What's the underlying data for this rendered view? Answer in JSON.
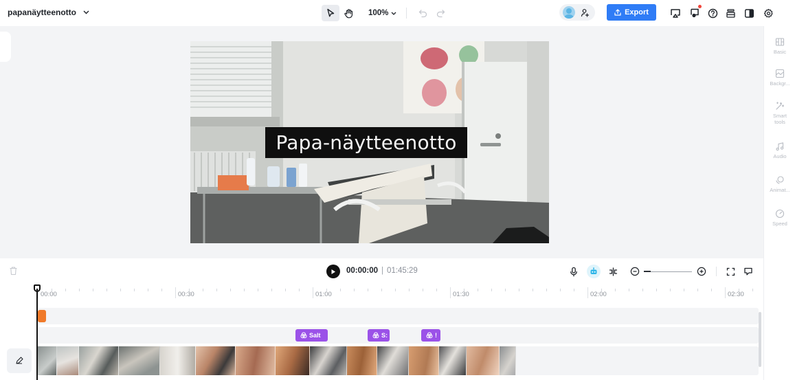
{
  "header": {
    "project_name": "papanäytteenotto",
    "zoom": "100%",
    "export_label": "Export"
  },
  "canvas": {
    "caption": "Papa-näytteenotto"
  },
  "right_panel": {
    "items": [
      {
        "label": "Basic"
      },
      {
        "label": "Backgr..."
      },
      {
        "label": "Smart tools"
      },
      {
        "label": "Audio"
      },
      {
        "label": "Animat..."
      },
      {
        "label": "Speed"
      }
    ]
  },
  "playback": {
    "current_time": "00:00:00",
    "separator": "|",
    "total_time": "01:45:29",
    "zoom_level": 0.14
  },
  "timeline": {
    "ruler_labels": [
      "00:00",
      "00:30",
      "01:00",
      "01:30",
      "02:00",
      "02:30"
    ],
    "effects": [
      {
        "label": "Salt"
      },
      {
        "label": "S:"
      },
      {
        "label": "!"
      }
    ]
  },
  "colors": {
    "accent": "#2f7cf6",
    "effect": "#9b52e8",
    "audio_clip": "#f07a2a"
  }
}
